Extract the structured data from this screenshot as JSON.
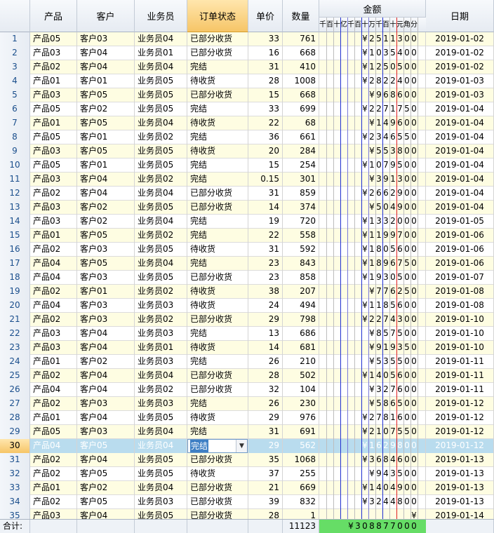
{
  "headers": {
    "product": "产品",
    "customer": "客户",
    "salesman": "业务员",
    "status": "订单状态",
    "price": "单价",
    "qty": "数量",
    "amount": "金额",
    "date": "日期"
  },
  "digit_headers": [
    "千",
    "百",
    "十",
    "亿",
    "千",
    "百",
    "十",
    "万",
    "千",
    "百",
    "十",
    "元",
    "角",
    "分"
  ],
  "rows": [
    {
      "n": "1",
      "product": "产品05",
      "customer": "客户03",
      "salesman": "业务员04",
      "status": "已部分收货",
      "price": "33",
      "qty": "761",
      "amount": "¥2511300",
      "date": "2019-01-02"
    },
    {
      "n": "2",
      "product": "产品03",
      "customer": "客户04",
      "salesman": "业务员01",
      "status": "已部分收货",
      "price": "16",
      "qty": "668",
      "amount": "¥1035400",
      "date": "2019-01-02"
    },
    {
      "n": "3",
      "product": "产品02",
      "customer": "客户04",
      "salesman": "业务员04",
      "status": "完结",
      "price": "31",
      "qty": "410",
      "amount": "¥1250500",
      "date": "2019-01-02"
    },
    {
      "n": "4",
      "product": "产品01",
      "customer": "客户01",
      "salesman": "业务员05",
      "status": "待收货",
      "price": "28",
      "qty": "1008",
      "amount": "¥2822400",
      "date": "2019-01-03"
    },
    {
      "n": "5",
      "product": "产品03",
      "customer": "客户05",
      "salesman": "业务员05",
      "status": "已部分收货",
      "price": "15",
      "qty": "668",
      "amount": "¥968600",
      "date": "2019-01-03"
    },
    {
      "n": "6",
      "product": "产品05",
      "customer": "客户02",
      "salesman": "业务员05",
      "status": "完结",
      "price": "33",
      "qty": "699",
      "amount": "¥2271750",
      "date": "2019-01-04"
    },
    {
      "n": "7",
      "product": "产品01",
      "customer": "客户05",
      "salesman": "业务员04",
      "status": "待收货",
      "price": "22",
      "qty": "68",
      "amount": "¥149600",
      "date": "2019-01-04"
    },
    {
      "n": "8",
      "product": "产品05",
      "customer": "客户01",
      "salesman": "业务员02",
      "status": "完结",
      "price": "36",
      "qty": "661",
      "amount": "¥2346550",
      "date": "2019-01-04"
    },
    {
      "n": "9",
      "product": "产品03",
      "customer": "客户05",
      "salesman": "业务员05",
      "status": "待收货",
      "price": "20",
      "qty": "284",
      "amount": "¥553800",
      "date": "2019-01-04"
    },
    {
      "n": "10",
      "product": "产品05",
      "customer": "客户01",
      "salesman": "业务员05",
      "status": "完结",
      "price": "15",
      "qty": "254",
      "amount": "¥1079500",
      "date": "2019-01-04"
    },
    {
      "n": "11",
      "product": "产品03",
      "customer": "客户04",
      "salesman": "业务员02",
      "status": "完结",
      "price": "0.15",
      "qty": "301",
      "amount": "¥391300",
      "date": "2019-01-04"
    },
    {
      "n": "12",
      "product": "产品02",
      "customer": "客户04",
      "salesman": "业务员04",
      "status": "已部分收货",
      "price": "31",
      "qty": "859",
      "amount": "¥2662900",
      "date": "2019-01-04"
    },
    {
      "n": "13",
      "product": "产品03",
      "customer": "客户02",
      "salesman": "业务员05",
      "status": "已部分收货",
      "price": "14",
      "qty": "374",
      "amount": "¥504900",
      "date": "2019-01-04"
    },
    {
      "n": "14",
      "product": "产品03",
      "customer": "客户02",
      "salesman": "业务员04",
      "status": "完结",
      "price": "19",
      "qty": "720",
      "amount": "¥1332000",
      "date": "2019-01-05"
    },
    {
      "n": "15",
      "product": "产品01",
      "customer": "客户05",
      "salesman": "业务员02",
      "status": "完结",
      "price": "22",
      "qty": "558",
      "amount": "¥1199700",
      "date": "2019-01-06"
    },
    {
      "n": "16",
      "product": "产品02",
      "customer": "客户03",
      "salesman": "业务员05",
      "status": "待收货",
      "price": "31",
      "qty": "592",
      "amount": "¥1805600",
      "date": "2019-01-06"
    },
    {
      "n": "17",
      "product": "产品04",
      "customer": "客户05",
      "salesman": "业务员04",
      "status": "完结",
      "price": "23",
      "qty": "843",
      "amount": "¥1896750",
      "date": "2019-01-06"
    },
    {
      "n": "18",
      "product": "产品04",
      "customer": "客户03",
      "salesman": "业务员05",
      "status": "已部分收货",
      "price": "23",
      "qty": "858",
      "amount": "¥1930500",
      "date": "2019-01-07"
    },
    {
      "n": "19",
      "product": "产品02",
      "customer": "客户01",
      "salesman": "业务员02",
      "status": "待收货",
      "price": "38",
      "qty": "207",
      "amount": "¥776250",
      "date": "2019-01-08"
    },
    {
      "n": "20",
      "product": "产品04",
      "customer": "客户03",
      "salesman": "业务员03",
      "status": "待收货",
      "price": "24",
      "qty": "494",
      "amount": "¥1185600",
      "date": "2019-01-08"
    },
    {
      "n": "21",
      "product": "产品02",
      "customer": "客户03",
      "salesman": "业务员02",
      "status": "已部分收货",
      "price": "29",
      "qty": "798",
      "amount": "¥2274300",
      "date": "2019-01-10"
    },
    {
      "n": "22",
      "product": "产品03",
      "customer": "客户04",
      "salesman": "业务员03",
      "status": "完结",
      "price": "13",
      "qty": "686",
      "amount": "¥857500",
      "date": "2019-01-10"
    },
    {
      "n": "23",
      "product": "产品03",
      "customer": "客户04",
      "salesman": "业务员01",
      "status": "待收货",
      "price": "14",
      "qty": "681",
      "amount": "¥919350",
      "date": "2019-01-10"
    },
    {
      "n": "24",
      "product": "产品01",
      "customer": "客户02",
      "salesman": "业务员03",
      "status": "完结",
      "price": "26",
      "qty": "210",
      "amount": "¥535500",
      "date": "2019-01-11"
    },
    {
      "n": "25",
      "product": "产品02",
      "customer": "客户04",
      "salesman": "业务员04",
      "status": "已部分收货",
      "price": "28",
      "qty": "502",
      "amount": "¥1405600",
      "date": "2019-01-11"
    },
    {
      "n": "26",
      "product": "产品04",
      "customer": "客户04",
      "salesman": "业务员02",
      "status": "已部分收货",
      "price": "32",
      "qty": "104",
      "amount": "¥327600",
      "date": "2019-01-11"
    },
    {
      "n": "27",
      "product": "产品02",
      "customer": "客户03",
      "salesman": "业务员03",
      "status": "完结",
      "price": "26",
      "qty": "230",
      "amount": "¥586500",
      "date": "2019-01-12"
    },
    {
      "n": "28",
      "product": "产品01",
      "customer": "客户04",
      "salesman": "业务员05",
      "status": "待收货",
      "price": "29",
      "qty": "976",
      "amount": "¥2781600",
      "date": "2019-01-12"
    },
    {
      "n": "29",
      "product": "产品05",
      "customer": "客户03",
      "salesman": "业务员04",
      "status": "完结",
      "price": "31",
      "qty": "691",
      "amount": "¥2107550",
      "date": "2019-01-12"
    },
    {
      "n": "30",
      "product": "产品04",
      "customer": "客户05",
      "salesman": "业务员04",
      "status": "完结",
      "price": "29",
      "qty": "562",
      "amount": "¥1629800",
      "date": "2019-01-12"
    },
    {
      "n": "31",
      "product": "产品02",
      "customer": "客户04",
      "salesman": "业务员05",
      "status": "已部分收货",
      "price": "35",
      "qty": "1068",
      "amount": "¥3684600",
      "date": "2019-01-13"
    },
    {
      "n": "32",
      "product": "产品02",
      "customer": "客户05",
      "salesman": "业务员05",
      "status": "待收货",
      "price": "37",
      "qty": "255",
      "amount": "¥943500",
      "date": "2019-01-13"
    },
    {
      "n": "33",
      "product": "产品01",
      "customer": "客户02",
      "salesman": "业务员04",
      "status": "已部分收货",
      "price": "21",
      "qty": "669",
      "amount": "¥1404900",
      "date": "2019-01-13"
    },
    {
      "n": "34",
      "product": "产品02",
      "customer": "客户05",
      "salesman": "业务员03",
      "status": "已部分收货",
      "price": "39",
      "qty": "832",
      "amount": "¥3244800",
      "date": "2019-01-13"
    },
    {
      "n": "35",
      "product": "产品03",
      "customer": "客户04",
      "salesman": "业务员05",
      "status": "已部分收货",
      "price": "28",
      "qty": "1",
      "amount": "¥",
      "date": "2019-01-14"
    }
  ],
  "selected_row": "30",
  "footer": {
    "label": "合计:",
    "qty_total": "11123",
    "amount_total": "¥308877000"
  },
  "colors": {
    "row_alt": "#fefde2",
    "selected_row": "#b9dcee",
    "header_selected": "#f6c567",
    "total_green": "#66dd66",
    "line_blue": "#1f2fd0",
    "line_red": "#e02020"
  }
}
